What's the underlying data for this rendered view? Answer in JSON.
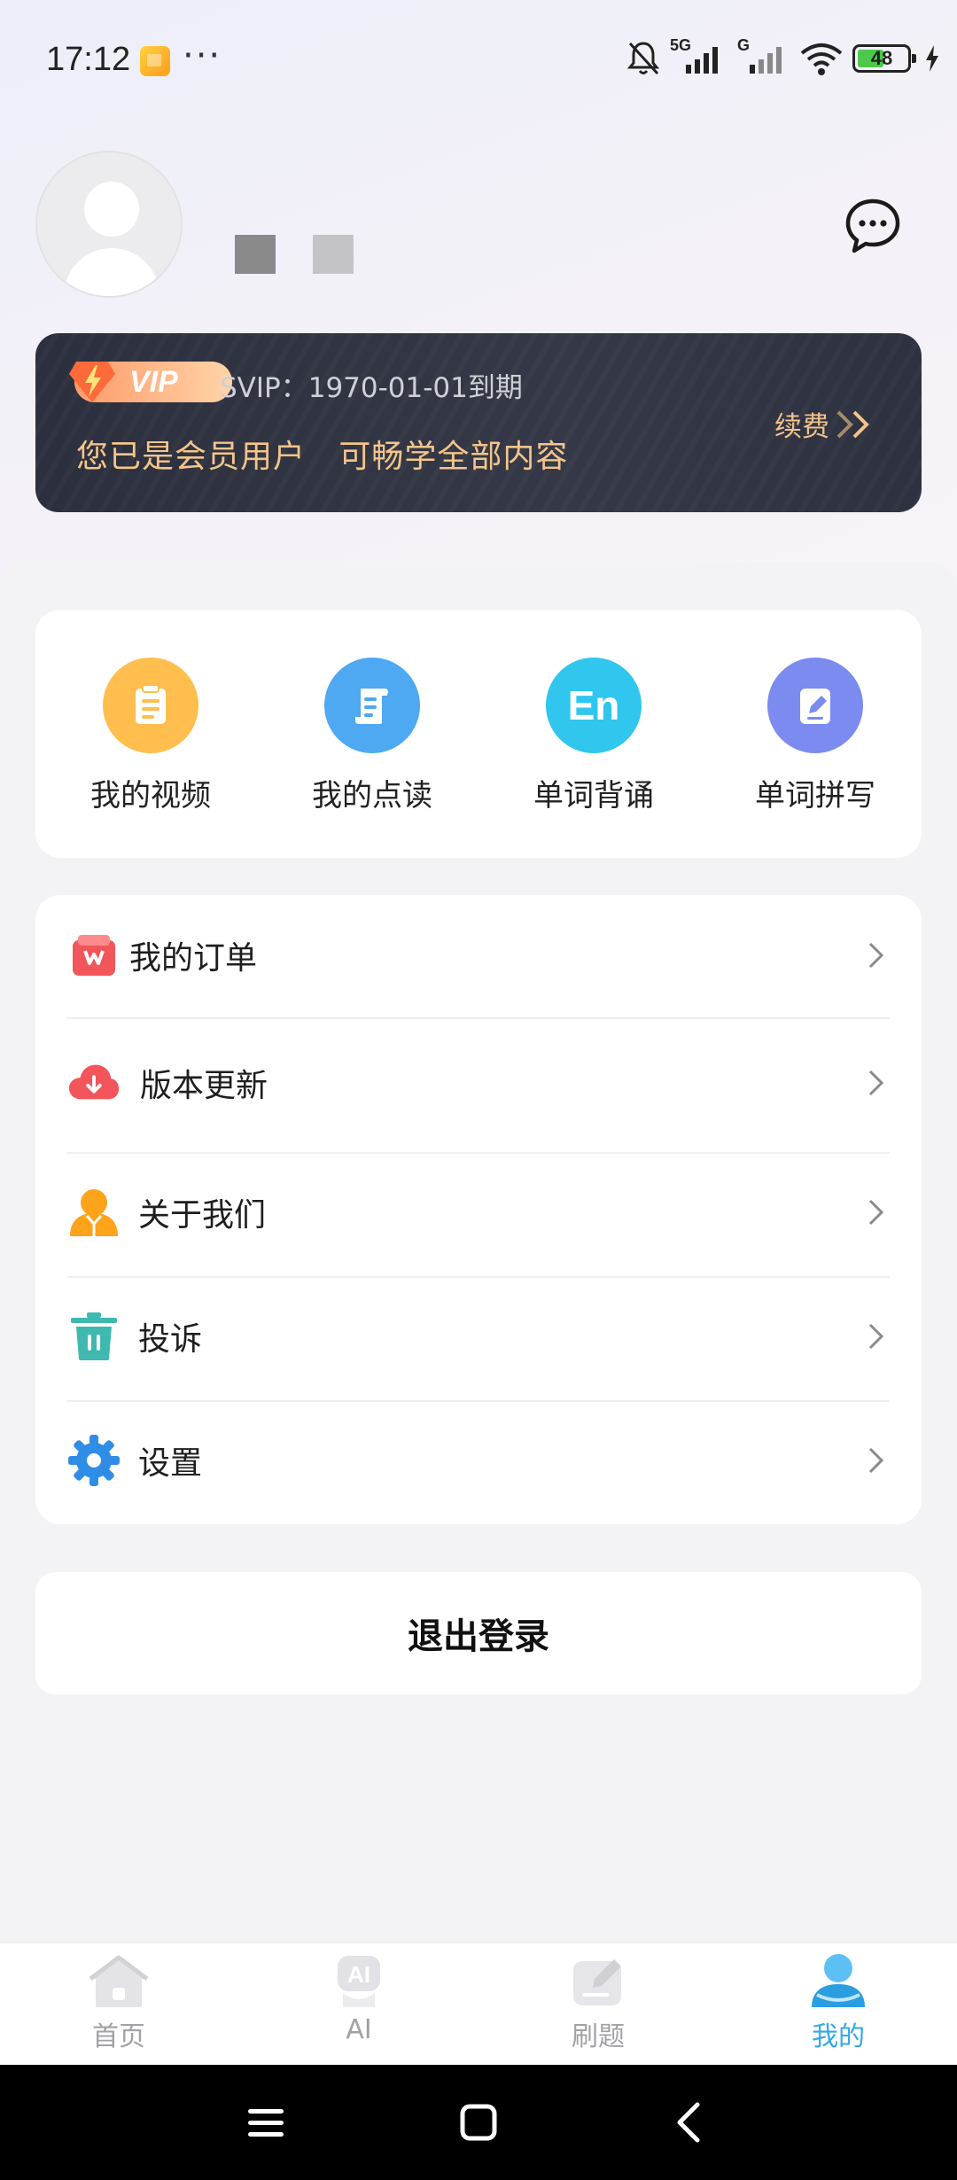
{
  "status_bar": {
    "time": "17:12",
    "more": "···",
    "network_label_1": "5G",
    "network_label_2": "G",
    "battery": "48"
  },
  "profile": {
    "avatar_icon": "default-avatar-icon",
    "message_icon": "chat-bubble-icon"
  },
  "vip": {
    "badge": "VIP",
    "expire": "SVIP：1970-01-01到期",
    "desc": "您已是会员用户   可畅学全部内容",
    "renew": "续费",
    "colors": {
      "card": "#2f3241",
      "gold": "#f5c58a"
    }
  },
  "quick_actions": [
    {
      "label": "我的视频",
      "icon": "video-doc-icon",
      "color": "#ffbe4d"
    },
    {
      "label": "我的点读",
      "icon": "book-scroll-icon",
      "color": "#4ea8f2"
    },
    {
      "label": "单词背诵",
      "icon": "en-icon",
      "glyph": "En",
      "color": "#30c6ee"
    },
    {
      "label": "单词拼写",
      "icon": "edit-note-icon",
      "color": "#7b8bf0"
    }
  ],
  "menu": [
    {
      "label": "我的订单",
      "icon": "order-bag-icon"
    },
    {
      "label": "版本更新",
      "icon": "cloud-download-icon"
    },
    {
      "label": "关于我们",
      "icon": "person-info-icon"
    },
    {
      "label": "投诉",
      "icon": "trash-icon"
    },
    {
      "label": "设置",
      "icon": "gear-icon"
    }
  ],
  "logout": "退出登录",
  "tabs": [
    {
      "label": "首页",
      "icon": "home-icon",
      "active": false
    },
    {
      "label": "AI",
      "icon": "ai-robot-icon",
      "active": false
    },
    {
      "label": "刷题",
      "icon": "practice-icon",
      "active": false
    },
    {
      "label": "我的",
      "icon": "profile-icon",
      "active": true
    }
  ],
  "colors": {
    "accent": "#35a8e8",
    "tab_inactive": "#a2a2a6"
  }
}
